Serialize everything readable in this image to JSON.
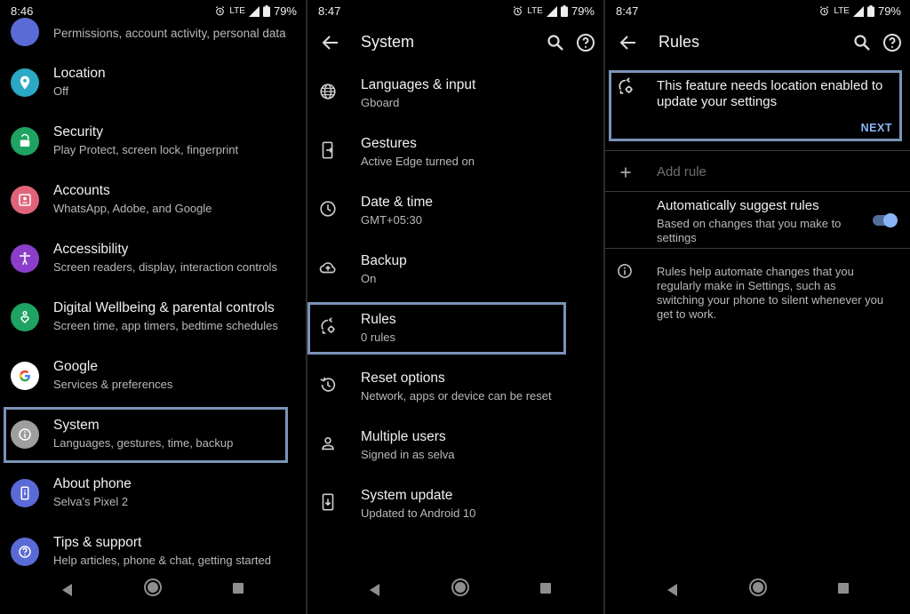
{
  "colors": {
    "location": "#2aa8c4",
    "security": "#1ea362",
    "accounts": "#e0637a",
    "accessibility": "#8b3ec9",
    "wellbeing": "#1ea362",
    "google": "#ffffff",
    "system": "#9e9e9e",
    "about": "#5a6ad6",
    "tips": "#5a6ad6",
    "highlight": "#7a93b8",
    "accent": "#8ab4f8"
  },
  "panel1": {
    "status": {
      "time": "8:46",
      "network": "LTE",
      "battery": "79%"
    },
    "partial_item": {
      "subtitle": "Permissions, account activity, personal data"
    },
    "items": [
      {
        "title": "Location",
        "subtitle": "Off",
        "icon": "location-pin-icon"
      },
      {
        "title": "Security",
        "subtitle": "Play Protect, screen lock, fingerprint",
        "icon": "lock-icon"
      },
      {
        "title": "Accounts",
        "subtitle": "WhatsApp, Adobe, and Google",
        "icon": "account-box-icon"
      },
      {
        "title": "Accessibility",
        "subtitle": "Screen readers, display, interaction controls",
        "icon": "accessibility-icon"
      },
      {
        "title": "Digital Wellbeing & parental controls",
        "subtitle": "Screen time, app timers, bedtime schedules",
        "icon": "wellbeing-heart-icon"
      },
      {
        "title": "Google",
        "subtitle": "Services & preferences",
        "icon": "google-g-icon"
      },
      {
        "title": "System",
        "subtitle": "Languages, gestures, time, backup",
        "icon": "info-icon"
      },
      {
        "title": "About phone",
        "subtitle": "Selva's Pixel 2",
        "icon": "phone-icon"
      },
      {
        "title": "Tips & support",
        "subtitle": "Help articles, phone & chat, getting started",
        "icon": "help-icon"
      }
    ]
  },
  "panel2": {
    "status": {
      "time": "8:47",
      "network": "LTE",
      "battery": "79%"
    },
    "title": "System",
    "items": [
      {
        "title": "Languages & input",
        "subtitle": "Gboard",
        "icon": "globe-icon"
      },
      {
        "title": "Gestures",
        "subtitle": "Active Edge turned on",
        "icon": "gesture-phone-icon"
      },
      {
        "title": "Date & time",
        "subtitle": "GMT+05:30",
        "icon": "clock-icon"
      },
      {
        "title": "Backup",
        "subtitle": "On",
        "icon": "cloud-upload-icon"
      },
      {
        "title": "Rules",
        "subtitle": "0 rules",
        "icon": "rules-icon"
      },
      {
        "title": "Reset options",
        "subtitle": "Network, apps or device can be reset",
        "icon": "history-icon"
      },
      {
        "title": "Multiple users",
        "subtitle": "Signed in as selva",
        "icon": "person-icon"
      },
      {
        "title": "System update",
        "subtitle": "Updated to Android 10",
        "icon": "system-update-icon"
      }
    ]
  },
  "panel3": {
    "status": {
      "time": "8:47",
      "network": "LTE",
      "battery": "79%"
    },
    "title": "Rules",
    "banner": {
      "line1": "This feature needs location enabled to",
      "line2": "update your settings",
      "action": "NEXT"
    },
    "add_rule": "Add rule",
    "auto_suggest": {
      "title": "Automatically suggest rules",
      "line1": "Based on changes that you make to",
      "line2": "settings",
      "enabled": true
    },
    "info": {
      "line1": "Rules help automate changes that you",
      "line2": "regularly make in Settings, such as",
      "line3": "switching your phone to silent whenever you",
      "line4": "get to work."
    }
  }
}
